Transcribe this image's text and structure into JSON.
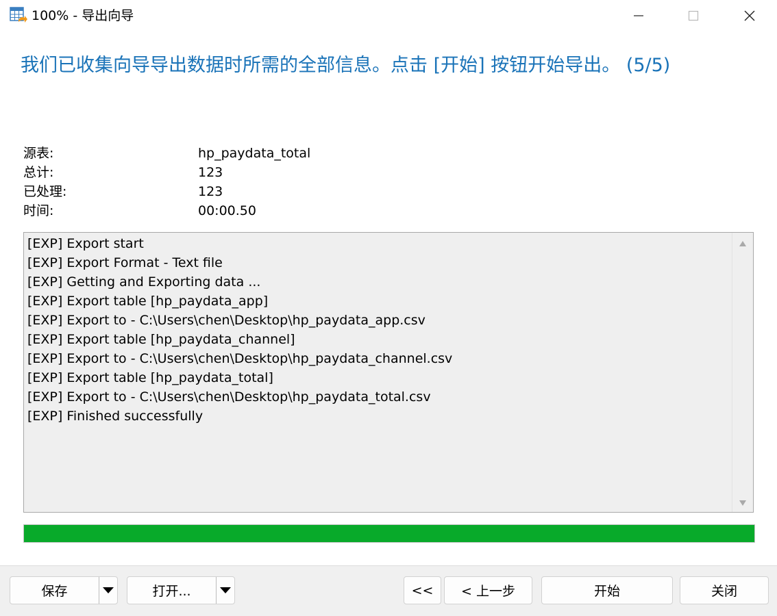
{
  "window": {
    "title": "100% - 导出向导",
    "controls": {
      "minimize": "minimize-icon",
      "maximize": "maximize-icon",
      "close": "close-icon"
    }
  },
  "headline": "我们已收集向导导出数据时所需的全部信息。点击 [开始] 按钮开始导出。 (5/5)",
  "info": [
    {
      "label": "源表:",
      "value": "hp_paydata_total"
    },
    {
      "label": "总计:",
      "value": "123"
    },
    {
      "label": "已处理:",
      "value": "123"
    },
    {
      "label": "时间:",
      "value": "00:00.50"
    }
  ],
  "log": [
    "[EXP] Export start",
    "[EXP] Export Format - Text file",
    "[EXP] Getting and Exporting data ...",
    "[EXP] Export table [hp_paydata_app]",
    "[EXP] Export to - C:\\Users\\chen\\Desktop\\hp_paydata_app.csv",
    "[EXP] Export table [hp_paydata_channel]",
    "[EXP] Export to - C:\\Users\\chen\\Desktop\\hp_paydata_channel.csv",
    "[EXP] Export table [hp_paydata_total]",
    "[EXP] Export to - C:\\Users\\chen\\Desktop\\hp_paydata_total.csv",
    "[EXP] Finished successfully"
  ],
  "progress": {
    "percent": 100,
    "color": "#08aa2a"
  },
  "buttons": {
    "save": "保存",
    "open": "打开...",
    "first": "<<",
    "back": "< 上一步",
    "start": "开始",
    "close": "关闭"
  },
  "colors": {
    "headline": "#1a73b8",
    "log_background": "#efefef"
  }
}
